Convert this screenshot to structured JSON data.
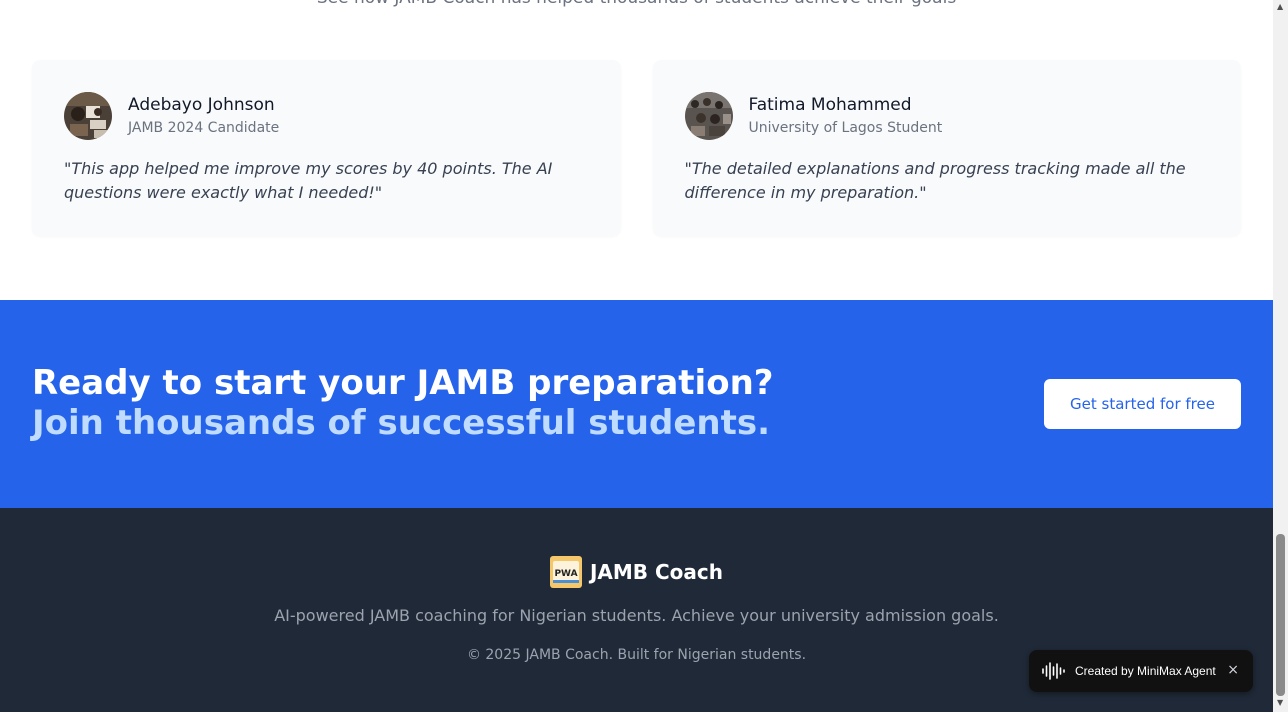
{
  "section": {
    "subtitle": "See how JAMB Coach has helped thousands of students achieve their goals"
  },
  "testimonials": [
    {
      "name": "Adebayo Johnson",
      "role": "JAMB 2024 Candidate",
      "quote": "\"This app helped me improve my scores by 40 points. The AI questions were exactly what I needed!\""
    },
    {
      "name": "Fatima Mohammed",
      "role": "University of Lagos Student",
      "quote": "\"The detailed explanations and progress tracking made all the difference in my preparation.\""
    }
  ],
  "cta": {
    "heading": "Ready to start your JAMB preparation?",
    "subheading": "Join thousands of successful students.",
    "button_label": "Get started for free"
  },
  "footer": {
    "brand": "JAMB Coach",
    "logo_text": "PWA",
    "tagline": "AI-powered JAMB coaching for Nigerian students. Achieve your university admission goals.",
    "copyright": "© 2025 JAMB Coach. Built for Nigerian students."
  },
  "badge": {
    "label": "Created by MiniMax Agent",
    "close": "×"
  },
  "scrollbar": {
    "up": "▲",
    "down": "▼"
  },
  "colors": {
    "accent": "#2563eb",
    "accent_light": "#bfdbfe",
    "footer_bg": "#1f2937"
  }
}
